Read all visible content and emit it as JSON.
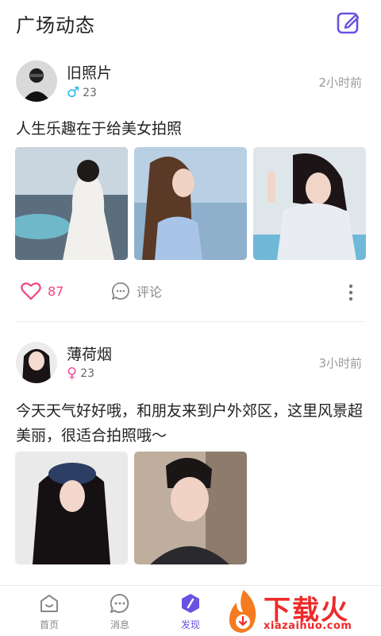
{
  "header": {
    "title": "广场动态"
  },
  "posts": [
    {
      "username": "旧照片",
      "gender_symbol": "♂",
      "age": "23",
      "time": "2小时前",
      "text": "人生乐趣在于给美女拍照",
      "likes": "87",
      "comment_label": "评论"
    },
    {
      "username": "薄荷烟",
      "gender_symbol": "♀",
      "age": "23",
      "time": "3小时前",
      "text": "今天天气好好哦，和朋友来到户外郊区，这里风景超美丽，很适合拍照哦～"
    }
  ],
  "tabs": [
    {
      "label": "首页"
    },
    {
      "label": "消息"
    },
    {
      "label": "发现"
    }
  ],
  "watermark": {
    "title": "下载火",
    "url": "xiazaihuo.com"
  },
  "colors": {
    "accent": "#6c52e0",
    "like": "#f2457f",
    "male": "#27b8e8",
    "female": "#f24fa0"
  }
}
